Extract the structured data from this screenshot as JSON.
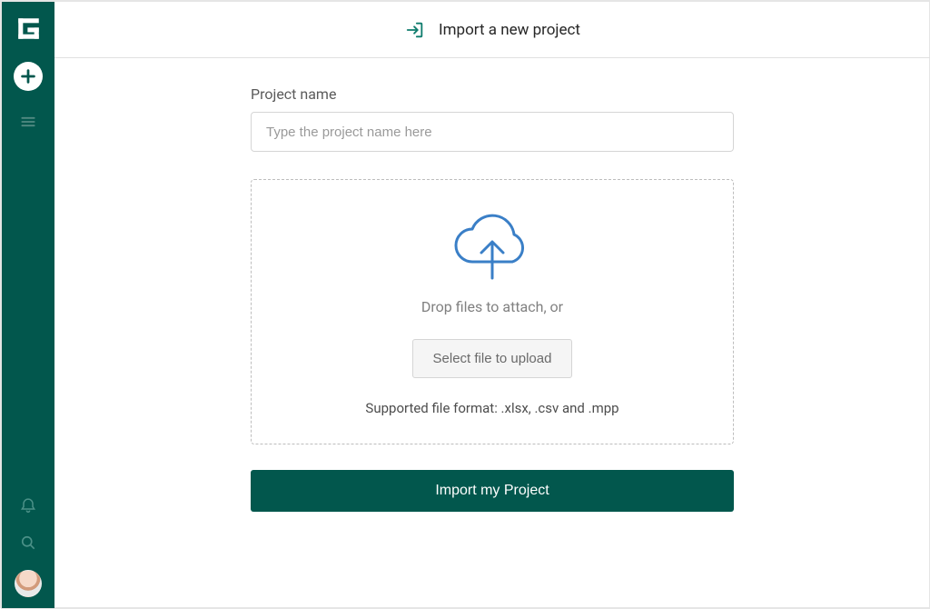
{
  "header": {
    "title": "Import a new project"
  },
  "form": {
    "project_name_label": "Project name",
    "project_name_placeholder": "Type the project name here",
    "project_name_value": "",
    "drop_text": "Drop files to attach, or",
    "select_file_label": "Select file to upload",
    "supported_text": "Supported file format: .xlsx, .csv and .mpp",
    "submit_label": "Import my Project"
  },
  "colors": {
    "brand": "#02574d",
    "accent_blue": "#3a7fc7"
  }
}
